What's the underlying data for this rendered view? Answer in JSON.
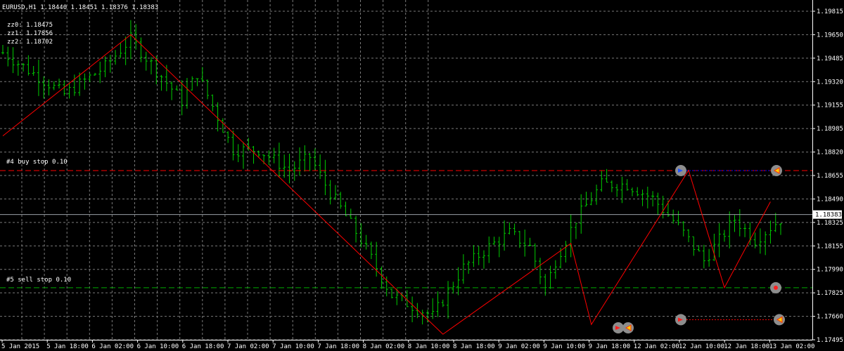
{
  "header": {
    "symbol": "EURUSD,H1",
    "ohlc": "1.18440 1.18451 1.18376 1.18383"
  },
  "indicator": {
    "zz0": "zz0: 1.18475",
    "zz1": "zz1: 1.17856",
    "zz2": "zz2: 1.18702"
  },
  "orders": {
    "buy_label": "#4 buy stop 0.10",
    "sell_label": "#5 sell stop 0.10",
    "buy_price": 1.187,
    "sell_price": 1.17855,
    "stop_price": 1.17625
  },
  "colors": {
    "background": "#000000",
    "grid": "#7a7a7a",
    "bar": "#00cc00",
    "zigzag": "#ff0000",
    "buy_line": "#ff0000",
    "sell_line": "#00aa00",
    "current_price_line": "#9aa0a6",
    "blue_line": "#0000ff"
  },
  "chart_data": {
    "type": "ohlc",
    "title": "EURUSD,H1",
    "ylim": [
      1.1748,
      1.1993
    ],
    "current_price": "1.18383",
    "y_ticks": [
      "1.19815",
      "1.19650",
      "1.19485",
      "1.19320",
      "1.19155",
      "1.18985",
      "1.18820",
      "1.18655",
      "1.18490",
      "1.18325",
      "1.18155",
      "1.17990",
      "1.17825",
      "1.17660",
      "1.17495"
    ],
    "x_ticks": [
      "5 Jan 2015",
      "5 Jan 18:00",
      "6 Jan 02:00",
      "6 Jan 10:00",
      "6 Jan 18:00",
      "7 Jan 02:00",
      "7 Jan 10:00",
      "7 Jan 18:00",
      "8 Jan 02:00",
      "8 Jan 10:00",
      "8 Jan 18:00",
      "9 Jan 02:00",
      "9 Jan 10:00",
      "9 Jan 18:00",
      "12 Jan 02:00",
      "12 Jan 10:00",
      "12 Jan 18:00",
      "13 Jan 02:00"
    ],
    "bar_count": 128,
    "bar_anchors": [
      [
        0,
        1.1955
      ],
      [
        12,
        1.1925
      ],
      [
        20,
        1.1945
      ],
      [
        25,
        1.1965
      ],
      [
        35,
        1.192
      ],
      [
        38,
        1.194
      ],
      [
        45,
        1.1885
      ],
      [
        50,
        1.1885
      ],
      [
        56,
        1.187
      ],
      [
        60,
        1.188
      ],
      [
        63,
        1.186
      ],
      [
        70,
        1.182
      ],
      [
        76,
        1.178
      ],
      [
        84,
        1.1765
      ],
      [
        90,
        1.18
      ],
      [
        95,
        1.1815
      ],
      [
        99,
        1.1825
      ],
      [
        103,
        1.1815
      ],
      [
        106,
        1.1785
      ],
      [
        108,
        1.1805
      ],
      [
        112,
        1.1835
      ],
      [
        117,
        1.186
      ],
      [
        122,
        1.186
      ],
      [
        127,
        1.185
      ],
      [
        132,
        1.183
      ],
      [
        137,
        1.1805
      ],
      [
        140,
        1.182
      ],
      [
        143,
        1.1835
      ],
      [
        147,
        1.182
      ],
      [
        152,
        1.1835
      ]
    ],
    "zigzag": [
      [
        0,
        1.1895
      ],
      [
        25,
        1.1968
      ],
      [
        86,
        1.1752
      ],
      [
        111,
        1.18175
      ],
      [
        115,
        1.1759
      ],
      [
        134,
        1.18702
      ],
      [
        141,
        1.17856
      ],
      [
        150,
        1.18475
      ]
    ]
  }
}
